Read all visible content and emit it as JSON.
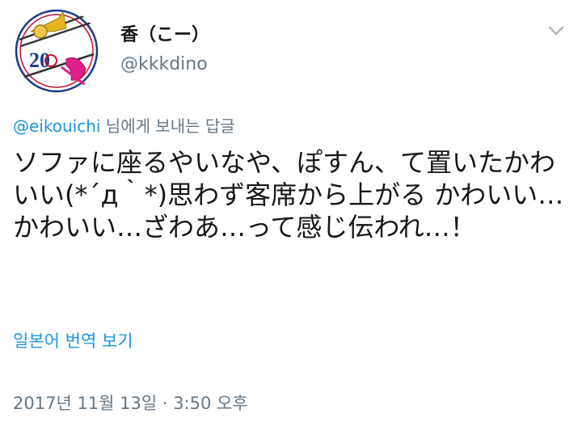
{
  "tweet": {
    "display_name": "香（こー）",
    "handle": "@kkkdino",
    "avatar_badge": "20",
    "reply_mention": "@eikouichi",
    "reply_suffix": " 님에게 보내는 답글",
    "text": "ソファに座るやいなや、ぽすん、て置いたかわいい(*´д｀*)思わず客席から上がる かわいい…かわいい…ざわあ…って感じ伝われ…！",
    "translate_label": "일본어 번역 보기",
    "timestamp": "2017년 11월 13일 · 3:50 오후"
  },
  "icons": {
    "avatar": "trombone-avatar-icon",
    "menu": "chevron-down-icon"
  },
  "colors": {
    "text_primary": "#14171a",
    "text_secondary": "#657786",
    "link": "#1b95e0",
    "avatar_ring": "#1a3a8a",
    "avatar_badge": "#c8102e"
  }
}
